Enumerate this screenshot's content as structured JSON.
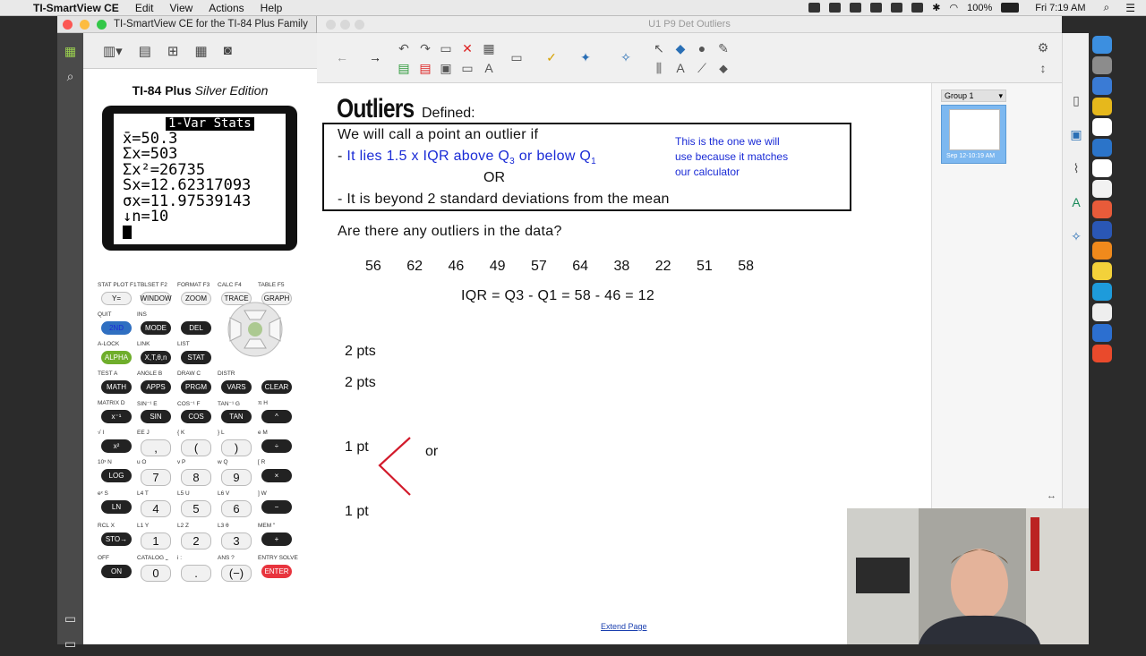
{
  "menubar": {
    "app_name": "TI-SmartView CE",
    "items": [
      "Edit",
      "View",
      "Actions",
      "Help"
    ],
    "battery": "100%",
    "clock": "Fri 7:19 AM"
  },
  "ti_window": {
    "title": "TI-SmartView CE for the TI-84 Plus Family",
    "brand_bold": "TI-84 Plus",
    "brand_italic": "Silver Edition",
    "screen": {
      "header": "1-Var Stats",
      "lines": [
        "x̄=50.3",
        "Σx=503",
        "Σx²=26735",
        "Sx=12.62317093",
        "σx=11.97539143",
        "↓n=10"
      ]
    },
    "keys": {
      "row1": [
        "Y=",
        "WINDOW",
        "ZOOM",
        "TRACE",
        "GRAPH"
      ],
      "row1_labels": [
        "STAT PLOT F1",
        "TBLSET F2",
        "FORMAT F3",
        "CALC F4",
        "TABLE F5"
      ],
      "row2": [
        "2ND",
        "MODE",
        "DEL"
      ],
      "row2_labels": [
        "QUIT",
        "INS"
      ],
      "row3": [
        "ALPHA",
        "X,T,θ,n",
        "STAT"
      ],
      "row3_labels": [
        "A-LOCK",
        "LINK",
        "LIST"
      ],
      "row4": [
        "MATH",
        "APPS",
        "PRGM",
        "VARS",
        "CLEAR"
      ],
      "row4_labels": [
        "TEST A",
        "ANGLE B",
        "DRAW C",
        "DISTR"
      ],
      "row5": [
        "x⁻¹",
        "SIN",
        "COS",
        "TAN",
        "^"
      ],
      "row5_labels": [
        "MATRIX D",
        "SIN⁻¹ E",
        "COS⁻¹ F",
        "TAN⁻¹ G",
        "π H"
      ],
      "row6": [
        "x²",
        ",",
        "(",
        ")",
        "÷"
      ],
      "row6_labels": [
        "√ I",
        "EE J",
        "{ K",
        "} L",
        "e M"
      ],
      "row7": [
        "LOG",
        "7",
        "8",
        "9",
        "×"
      ],
      "row7_labels": [
        "10ˣ N",
        "u O",
        "v P",
        "w Q",
        "[ R"
      ],
      "row8": [
        "LN",
        "4",
        "5",
        "6",
        "−"
      ],
      "row8_labels": [
        "eˣ S",
        "L4 T",
        "L5 U",
        "L6 V",
        "] W"
      ],
      "row9": [
        "STO→",
        "1",
        "2",
        "3",
        "+"
      ],
      "row9_labels": [
        "RCL X",
        "L1 Y",
        "L2 Z",
        "L3 θ",
        "MEM \""
      ],
      "row10": [
        "ON",
        "0",
        ".",
        "(−)",
        "ENTER"
      ],
      "row10_labels": [
        "OFF",
        "CATALOG ⎵",
        "i :",
        "ANS ?",
        "ENTRY SOLVE"
      ]
    }
  },
  "smartview_window": {
    "title": "U1 P9 Det Outliers",
    "group_label": "Group 1",
    "thumb_date": "Sep 12-10:19 AM",
    "extend_page": "Extend Page"
  },
  "slide": {
    "heading": "Outliers",
    "defined": "Defined:",
    "box_line1": "We will call a point an outlier if",
    "box_line2_prefix": "- ",
    "box_line2_blue": "It lies 1.5 x IQR above Q",
    "box_line2_sub1": "3",
    "box_line2_mid": " or below Q",
    "box_line2_sub2": "1",
    "box_or": "OR",
    "box_line3": "- It is beyond 2 standard deviations from the mean",
    "side_note_1": "This is the one we will",
    "side_note_2": "use because it matches",
    "side_note_3": "our calculator",
    "question": "Are there any outliers in the data?",
    "data_values": [
      "56",
      "62",
      "46",
      "49",
      "57",
      "64",
      "38",
      "22",
      "51",
      "58"
    ],
    "iqr_line": "IQR = Q3 - Q1 = 58 - 46 = 12",
    "pts1": "2 pts",
    "pts2": "2 pts",
    "pts3": "1 pt",
    "or_word": "or",
    "pts4": "1 pt"
  }
}
